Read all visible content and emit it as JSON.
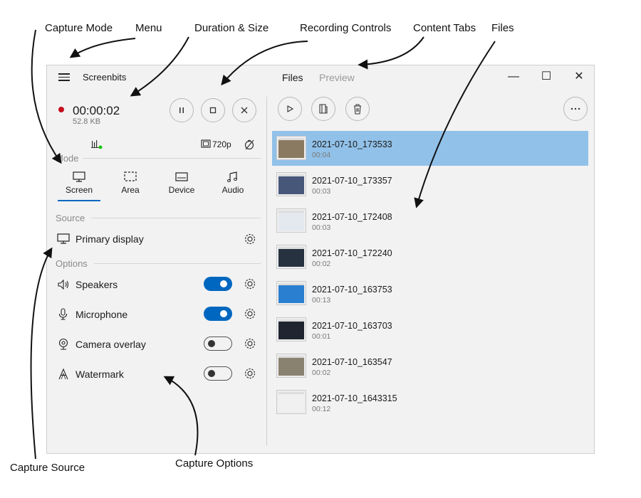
{
  "annotations": {
    "capture_mode": "Capture Mode",
    "menu": "Menu",
    "duration_size": "Duration & Size",
    "recording_controls": "Recording Controls",
    "content_tabs": "Content Tabs",
    "files": "Files",
    "capture_source": "Capture Source",
    "capture_options": "Capture Options"
  },
  "window": {
    "title": "Screenbits",
    "tabs": [
      "Files",
      "Preview"
    ],
    "active_tab": "Files",
    "controls": {
      "minimize": "—",
      "maximize": "☐",
      "close": "✕"
    }
  },
  "recording": {
    "elapsed": "00:00:02",
    "size": "52.8  KB",
    "resolution": "720p",
    "status_color": "#c50f1f"
  },
  "mode": {
    "label": "Mode",
    "items": [
      {
        "label": "Screen",
        "icon": "monitor-icon"
      },
      {
        "label": "Area",
        "icon": "area-select-icon"
      },
      {
        "label": "Device",
        "icon": "device-icon"
      },
      {
        "label": "Audio",
        "icon": "music-note-icon"
      }
    ],
    "selected": "Screen"
  },
  "source": {
    "label": "Source",
    "value": "Primary display"
  },
  "options": {
    "label": "Options",
    "items": [
      {
        "label": "Speakers",
        "icon": "speaker-icon",
        "enabled": true
      },
      {
        "label": "Microphone",
        "icon": "microphone-icon",
        "enabled": true
      },
      {
        "label": "Camera overlay",
        "icon": "webcam-icon",
        "enabled": false
      },
      {
        "label": "Watermark",
        "icon": "watermark-icon",
        "enabled": false
      }
    ]
  },
  "files": [
    {
      "name": "2021-07-10_173533",
      "duration": "00:04",
      "selected": true,
      "thumb_color": "#8a7a62"
    },
    {
      "name": "2021-07-10_173357",
      "duration": "00:03",
      "selected": false,
      "thumb_color": "#46577a"
    },
    {
      "name": "2021-07-10_172408",
      "duration": "00:03",
      "selected": false,
      "thumb_color": "#e4e8ef"
    },
    {
      "name": "2021-07-10_172240",
      "duration": "00:02",
      "selected": false,
      "thumb_color": "#273240"
    },
    {
      "name": "2021-07-10_163753",
      "duration": "00:13",
      "selected": false,
      "thumb_color": "#2b7fd1"
    },
    {
      "name": "2021-07-10_163703",
      "duration": "00:01",
      "selected": false,
      "thumb_color": "#1f2430"
    },
    {
      "name": "2021-07-10_163547",
      "duration": "00:02",
      "selected": false,
      "thumb_color": "#8a8270"
    },
    {
      "name": "2021-07-10_1643315",
      "duration": "00:12",
      "selected": false,
      "thumb_color": "#f0f0f0"
    }
  ],
  "colors": {
    "accent": "#0067c0",
    "selection": "#91c1e8",
    "window_bg": "#f2f2f2"
  }
}
